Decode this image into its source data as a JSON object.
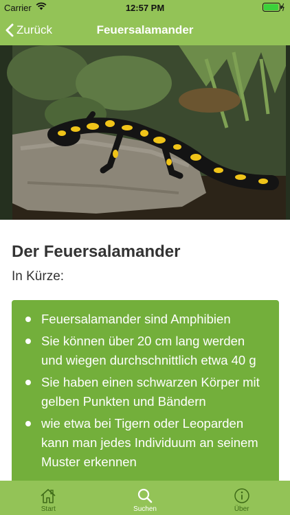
{
  "status_bar": {
    "carrier": "Carrier",
    "time": "12:57 PM",
    "battery_level": 0.95
  },
  "nav": {
    "back_label": "Zurück",
    "title": "Feuersalamander"
  },
  "hero_image": {
    "subject": "fire salamander on a rock"
  },
  "article": {
    "heading": "Der Feuersalamander",
    "subheading": "In Kürze:",
    "facts": [
      "Feuersalamander sind Amphibien",
      "Sie können über 20 cm lang werden und wiegen durchschnittlich etwa 40 g",
      "Sie haben einen schwarzen Körper mit gelben Punkten und Bändern",
      "wie etwa bei Tigern oder Leoparden kann man jedes Individuum an seinem Muster erkennen"
    ]
  },
  "tabs": [
    {
      "label": "Start",
      "icon": "home-icon",
      "active": false
    },
    {
      "label": "Suchen",
      "icon": "search-icon",
      "active": true
    },
    {
      "label": "Über",
      "icon": "info-icon",
      "active": false
    }
  ],
  "colors": {
    "bar_green": "#93c357",
    "card_green": "#73af3b",
    "tab_inactive": "#3f6b18"
  }
}
